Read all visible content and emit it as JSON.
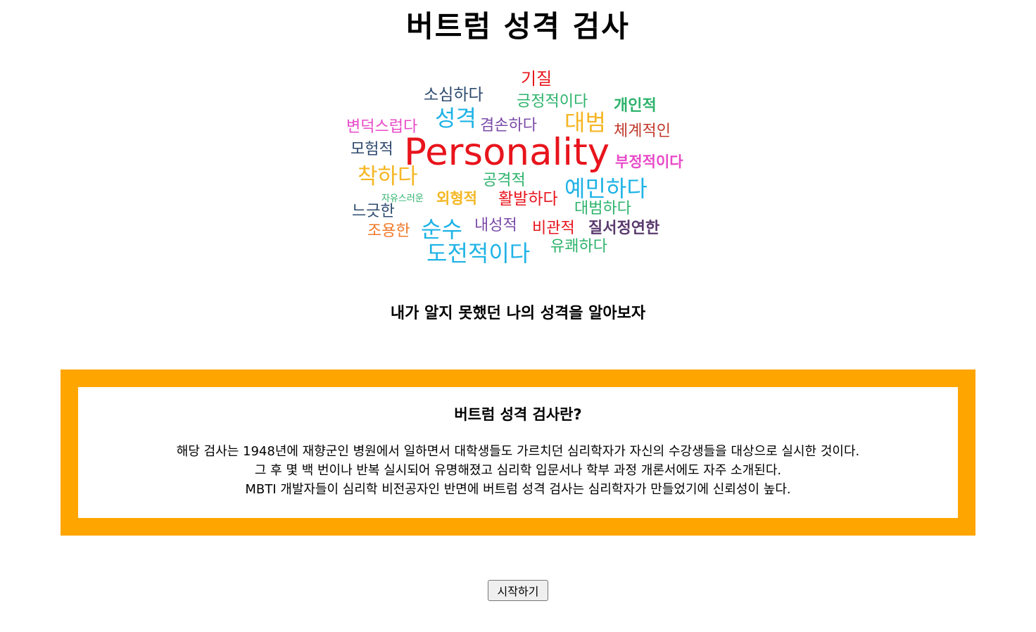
{
  "page": {
    "title": "버트럼 성격 검사",
    "subtitle": "내가 알지 못했던 나의 성격을 알아보자"
  },
  "wordcloud": {
    "words": [
      {
        "text": "Personality",
        "color": "#e8141c"
      },
      {
        "text": "기질",
        "color": "#e8141c"
      },
      {
        "text": "소심하다",
        "color": "#2d4a6e"
      },
      {
        "text": "긍정적이다",
        "color": "#2db36b"
      },
      {
        "text": "개인적",
        "color": "#2db36b"
      },
      {
        "text": "성격",
        "color": "#1fb3e6"
      },
      {
        "text": "변덕스럽다",
        "color": "#e84ac8"
      },
      {
        "text": "겸손하다",
        "color": "#7a4aa8"
      },
      {
        "text": "대범",
        "color": "#f5b623"
      },
      {
        "text": "체계적인",
        "color": "#c0392b"
      },
      {
        "text": "모험적",
        "color": "#2d4a6e"
      },
      {
        "text": "부정적이다",
        "color": "#e84ac8"
      },
      {
        "text": "착하다",
        "color": "#f5b623"
      },
      {
        "text": "공격적",
        "color": "#2db36b"
      },
      {
        "text": "예민하다",
        "color": "#1fb3e6"
      },
      {
        "text": "자유스러운",
        "color": "#2db36b"
      },
      {
        "text": "외형적",
        "color": "#f5b623"
      },
      {
        "text": "활발하다",
        "color": "#e8141c"
      },
      {
        "text": "대범하다",
        "color": "#2db36b"
      },
      {
        "text": "느긋한",
        "color": "#2d4a6e"
      },
      {
        "text": "조용한",
        "color": "#f07a2a"
      },
      {
        "text": "순수",
        "color": "#1fb3e6"
      },
      {
        "text": "내성적",
        "color": "#7a4aa8"
      },
      {
        "text": "비관적",
        "color": "#e8141c"
      },
      {
        "text": "질서정연한",
        "color": "#5a3a6e"
      },
      {
        "text": "도전적이다",
        "color": "#1fb3e6"
      },
      {
        "text": "유쾌하다",
        "color": "#2db36b"
      }
    ]
  },
  "info": {
    "heading": "버트럼 성격 검사란?",
    "lines": [
      "해당 검사는 1948년에 재향군인 병원에서 일하면서 대학생들도 가르치던 심리학자가 자신의 수강생들을 대상으로 실시한 것이다.",
      "그 후 몇 백 번이나 반복 실시되어 유명해졌고 심리학 입문서나 학부 과정 개론서에도 자주 소개된다.",
      "MBTI 개발자들이 심리학 비전공자인 반면에 버트럼 성격 검사는 심리학자가 만들었기에 신뢰성이 높다."
    ],
    "frame_color": "#FFA500"
  },
  "actions": {
    "start_label": "시작하기"
  }
}
